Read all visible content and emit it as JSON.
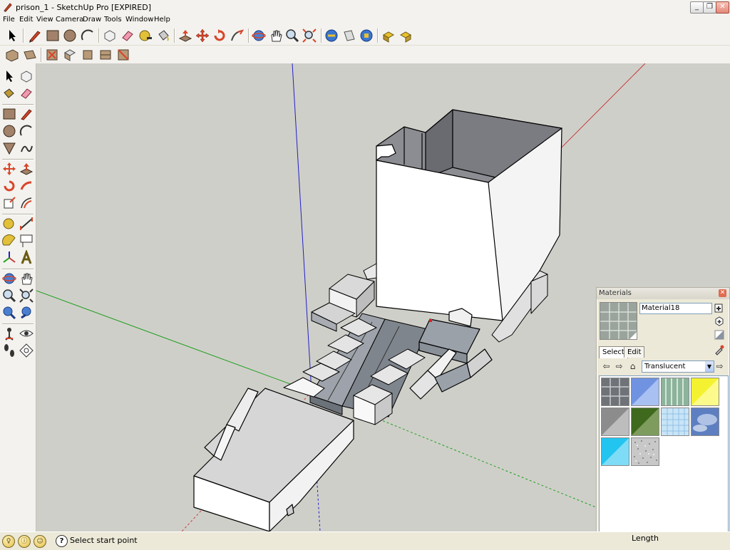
{
  "window": {
    "title": "prison_1 - SketchUp Pro [EXPIRED]",
    "minimize": "_",
    "maximize": "❐",
    "close": "✕"
  },
  "menu": [
    "File",
    "Edit",
    "View",
    "Camera",
    "Draw",
    "Tools",
    "Window",
    "Help"
  ],
  "main_toolbar": [
    "select-icon",
    "line-icon",
    "rectangle-icon",
    "circle-icon",
    "arc-icon",
    "make-component-icon",
    "eraser-icon",
    "tape-measure-icon",
    "paint-bucket-icon",
    "push-pull-icon",
    "move-icon",
    "rotate-icon",
    "follow-me-icon",
    "orbit-icon",
    "pan-icon",
    "zoom-icon",
    "zoom-extents-icon",
    "get-models-icon",
    "share-model-icon",
    "share-component-icon",
    "get-photo-texture-icon",
    "add-location-icon"
  ],
  "views_toolbar": [
    "iso-view-icon",
    "top-view-icon",
    "front-view-icon",
    "right-view-icon",
    "back-view-icon",
    "left-view-icon"
  ],
  "left_toolbar": [
    "select-icon",
    "make-component-icon",
    "paint-bucket-icon",
    "eraser-icon",
    "rectangle-icon",
    "line-icon",
    "circle-icon",
    "arc-icon",
    "polygon-icon",
    "freehand-icon",
    "move-icon",
    "push-pull-icon",
    "rotate-icon",
    "follow-me-icon",
    "scale-icon",
    "offset-icon",
    "tape-measure-icon",
    "dimension-icon",
    "protractor-icon",
    "text-icon",
    "axes-icon",
    "3d-text-icon",
    "orbit-icon",
    "pan-icon",
    "zoom-icon",
    "zoom-window-icon",
    "zoom-extents-icon",
    "previous-view-icon",
    "position-camera-icon",
    "look-around-icon",
    "walk-icon",
    "section-plane-icon"
  ],
  "status": {
    "text": "Select start point",
    "measure_label": "Length",
    "colors": {
      "accent": "#316ac5",
      "axis_red": "#c83c3c",
      "axis_green": "#20a020",
      "axis_blue": "#2020c8"
    }
  },
  "materials": {
    "title": "Materials",
    "close": "✕",
    "material_name": "Material18",
    "tabs": [
      {
        "label": "Select",
        "active": true
      },
      {
        "label": "Edit",
        "active": false
      }
    ],
    "library": "Translucent",
    "swatches": [
      {
        "name": "swatch-glass-block",
        "color": "#6f7378"
      },
      {
        "name": "swatch-blue-glass",
        "color": "#6f93e0"
      },
      {
        "name": "swatch-green-stripe-glass",
        "color": "#8cb39b"
      },
      {
        "name": "swatch-yellow-glass",
        "color": "#f4f230"
      },
      {
        "name": "swatch-gray-glass",
        "color": "#8c8c8c"
      },
      {
        "name": "swatch-green-glass",
        "color": "#3f6a1e"
      },
      {
        "name": "swatch-blue-grid-glass",
        "color": "#c9e4f6"
      },
      {
        "name": "swatch-sky-glass",
        "color": "#5d7fc1"
      },
      {
        "name": "swatch-cyan-glass",
        "color": "#22c4f0"
      },
      {
        "name": "swatch-speckle-glass",
        "color": "#c8c8c8"
      }
    ]
  }
}
